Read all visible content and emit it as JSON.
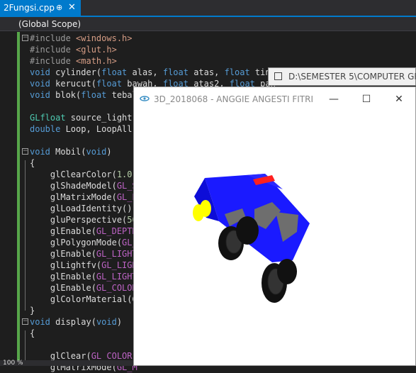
{
  "tab": {
    "title": "2Fungsi.cpp",
    "pin_glyph": "⊕",
    "close_glyph": "✕"
  },
  "scope": {
    "label": "(Global Scope)"
  },
  "status": {
    "zoom": "100 %"
  },
  "code": {
    "lines": [
      "#include <windows.h>",
      "#include <glut.h>",
      "#include <math.h>",
      "void cylinder(float alas, float atas, float ting",
      "void kerucut(float bawah, float atas2, float pan",
      "void blok(float tebal",
      "",
      "GLfloat source_light[",
      "double Loop, LoopAll",
      "",
      "void Mobil(void)",
      "{",
      "    glClearColor(1.0,",
      "    glShadeModel(GL_S",
      "    glMatrixMode(GL_P",
      "    glLoadIdentity();",
      "    gluPerspective(50",
      "    glEnable(GL_DEPTH",
      "    glPolygonMode(GL_",
      "    glEnable(GL_LIGHT",
      "    glLightfv(GL_LIGH",
      "    glEnable(GL_LIGHT",
      "    glEnable(GL_COLOR",
      "    glColorMaterial(G",
      "}",
      "void display(void)",
      "{",
      "",
      "    glClear(GL_COLOR_",
      "    glMatrixMode(GL_M"
    ]
  },
  "background_window": {
    "title": "D:\\SEMESTER 5\\COMPUTER GRAP"
  },
  "gl_window": {
    "title": "3D_2018068 - ANGGIE ANGESTI FITRI",
    "minimize_glyph": "—",
    "maximize_glyph": "☐",
    "close_glyph": "✕"
  },
  "colors": {
    "accent": "#007acc",
    "editor_bg": "#1e1e1e",
    "car_body": "#1a1aff",
    "car_window": "#6e6e6e",
    "wheel": "#111111",
    "headlight": "#ffff00",
    "siren": "#ff2020"
  }
}
